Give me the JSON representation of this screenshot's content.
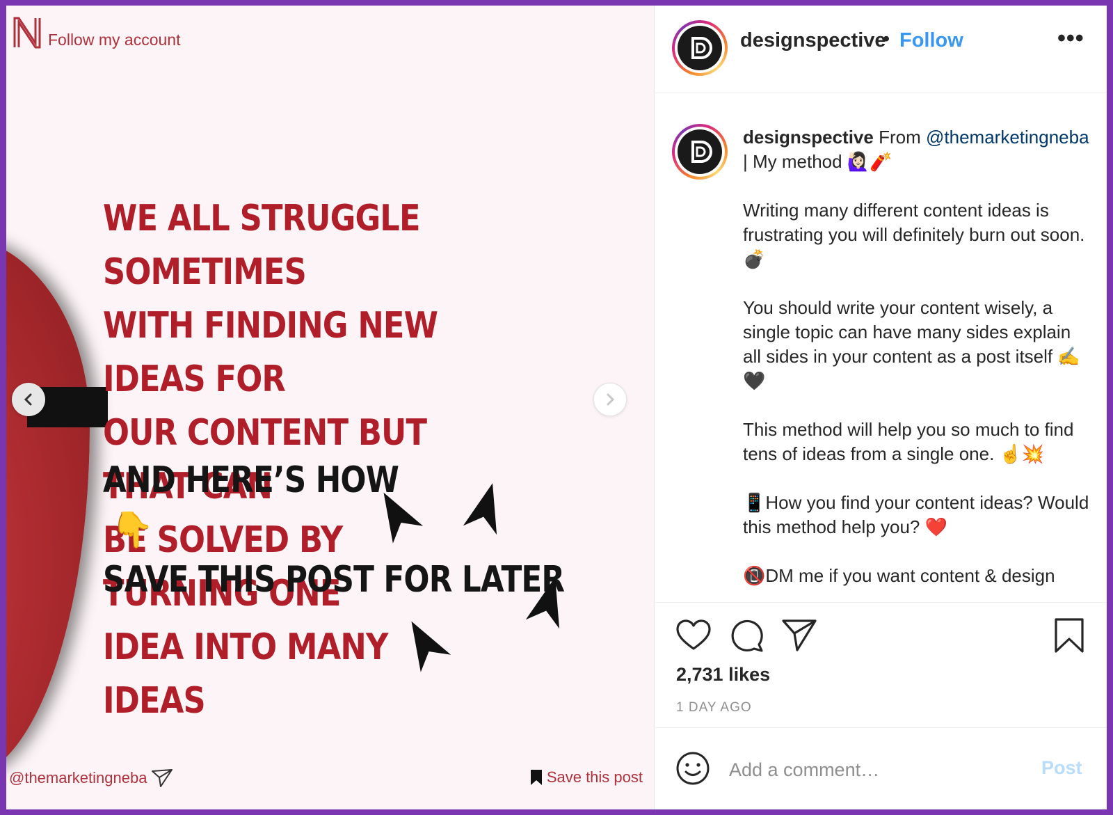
{
  "media": {
    "brand_link": "Follow my account",
    "headline_lines": [
      "WE ALL STRUGGLE SOMETIMES",
      "WITH FINDING NEW IDEAS FOR",
      "OUR CONTENT BUT THAT CAN",
      "BE SOLVED BY TURNING ONE",
      "IDEA INTO MANY IDEAS"
    ],
    "subline": "AND HERE’S HOW",
    "emoji": "👇",
    "save_line": "SAVE THIS POST FOR LATER",
    "footer_handle": "@themarketingneba",
    "footer_save": "Save this post"
  },
  "header": {
    "username": "designspective",
    "separator": "•",
    "follow_label": "Follow",
    "more_label": "•••"
  },
  "caption": {
    "username": "designspective",
    "intro_text": "From",
    "mention": "@themarketingneba",
    "intro_rest": "| My method 🙋🏻‍♀️🧨",
    "paragraph_1": "Writing many different content ideas is frustrating you will definitely burn out soon. 💣",
    "paragraph_2": "You should write your content wisely, a single topic can have many sides explain all sides in your content as a post itself ✍️ 🖤",
    "paragraph_3": "This method will help you so much to find tens of ideas from a single one. ☝️💥",
    "paragraph_4": "📱How you find your content ideas? Would this method help you? ❤️",
    "paragraph_5": "📵DM me if you want content & design"
  },
  "actions": {
    "likes": "2,731 likes",
    "time_ago": "1 DAY AGO"
  },
  "comment": {
    "placeholder": "Add a comment…",
    "post_label": "Post"
  },
  "colors": {
    "accent_red": "#b01e2a",
    "follow_blue": "#3897f0",
    "post_disabled": "#b9dcfb",
    "frame_purple": "#7a35b0"
  }
}
